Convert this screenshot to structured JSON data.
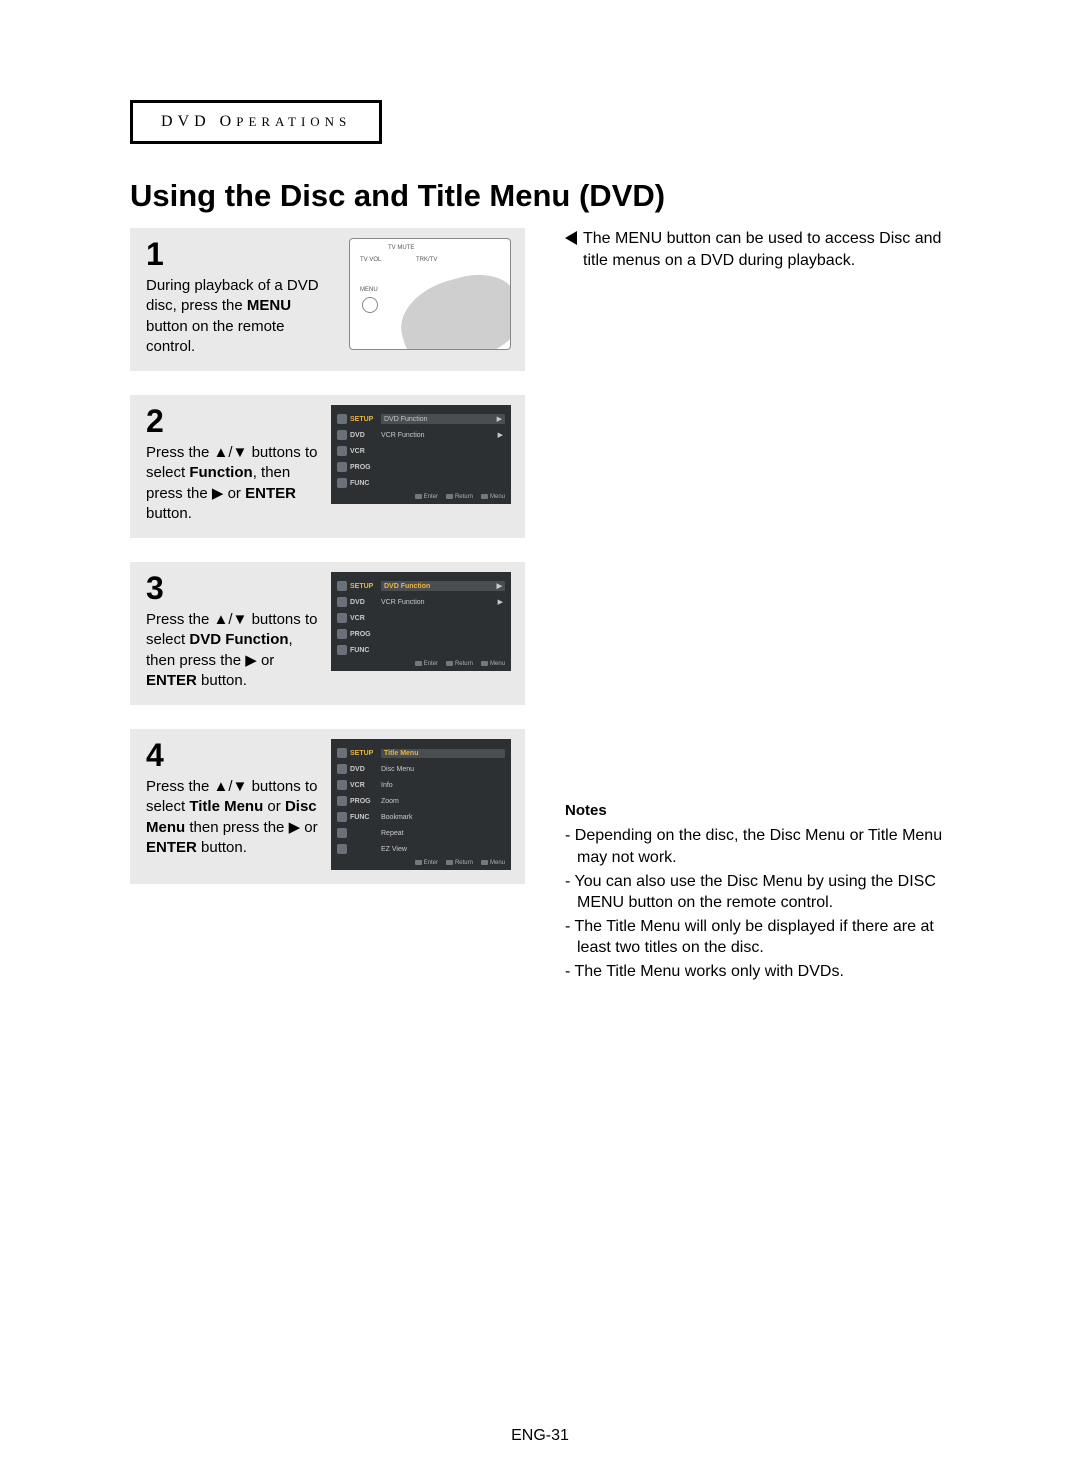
{
  "section_label": "DVD OPERATIONS",
  "page_title": "Using the Disc and Title Menu (DVD)",
  "tip_text": "The MENU button can be used to access Disc and title menus on a DVD during playback.",
  "steps": [
    {
      "num": "1",
      "desc_pre": "During playback of a DVD disc, press the ",
      "desc_bold": "MENU",
      "desc_post": " button on the remote control."
    },
    {
      "num": "2",
      "desc_a": "Press the ",
      "desc_b": " buttons to select ",
      "desc_bold1": "Function",
      "desc_c": ", then press the ",
      "desc_d": " or ",
      "desc_bold2": "ENTER",
      "desc_e": " button."
    },
    {
      "num": "3",
      "desc_a": "Press the ",
      "desc_b": " buttons to select ",
      "desc_bold1": "DVD Function",
      "desc_c": ", then press the ",
      "desc_d": " or ",
      "desc_bold2": "ENTER",
      "desc_e": " button."
    },
    {
      "num": "4",
      "desc_a": "Press the ",
      "desc_b": " buttons to select ",
      "desc_bold1": "Title Menu",
      "desc_mid": " or ",
      "desc_bold1b": "Disc Menu",
      "desc_c": " then press the ",
      "desc_d": " or ",
      "desc_bold2": "ENTER",
      "desc_e": " button."
    }
  ],
  "osd": {
    "side": [
      "SETUP",
      "DVD",
      "VCR",
      "PROG",
      "FUNC"
    ],
    "panelA": {
      "rows": [
        {
          "t": "DVD Function",
          "a": true
        },
        {
          "t": "VCR Function",
          "a": true
        }
      ],
      "hl": null
    },
    "panelB": {
      "rows": [
        {
          "t": "DVD Function",
          "a": true
        },
        {
          "t": "VCR Function",
          "a": true
        }
      ],
      "hl": 0
    },
    "panelC": {
      "rows": [
        {
          "t": "Title Menu",
          "a": false
        },
        {
          "t": "Disc Menu",
          "a": false
        },
        {
          "t": "Info",
          "a": false
        },
        {
          "t": "Zoom",
          "a": false
        },
        {
          "t": "Bookmark",
          "a": false
        },
        {
          "t": "Repeat",
          "a": false
        },
        {
          "t": "EZ View",
          "a": false
        }
      ],
      "hl": 0
    },
    "foot": [
      "Enter",
      "Return",
      "Menu"
    ]
  },
  "notes_title": "Notes",
  "notes": [
    "Depending on the disc, the Disc Menu or Title Menu may not work.",
    "You can also use the Disc Menu by using the DISC MENU button on the remote control.",
    "The Title Menu will only be displayed if there are at least two titles on the disc.",
    "The Title Menu works only with DVDs."
  ],
  "footer": "ENG-31",
  "glyphs": {
    "updown": "▲/▼",
    "right": "▶",
    "tri_right": "▶"
  }
}
